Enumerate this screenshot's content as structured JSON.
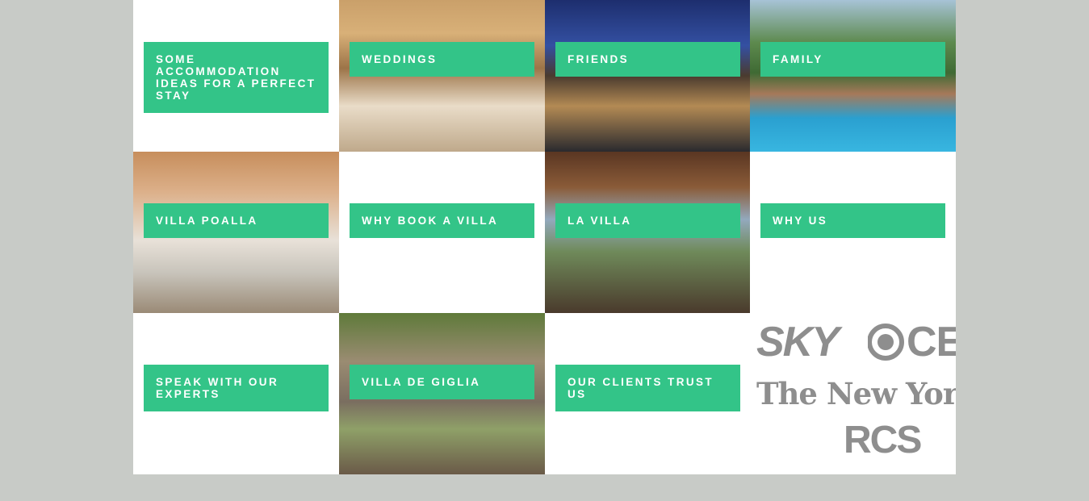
{
  "tiles": [
    {
      "label": "SOME ACCOMMODATION IDEAS FOR A PERFECT STAY"
    },
    {
      "label": "WEDDINGS"
    },
    {
      "label": "FRIENDS"
    },
    {
      "label": "FAMILY"
    },
    {
      "label": "VILLA POALLA"
    },
    {
      "label": "WHY BOOK A VILLA"
    },
    {
      "label": "LA VILLA"
    },
    {
      "label": "WHY US"
    },
    {
      "label": "SPEAK WITH OUR EXPERTS"
    },
    {
      "label": "VILLA DE GIGLIA"
    },
    {
      "label": "OUR CLIENTS TRUST US"
    }
  ],
  "press_logos": {
    "sky": "SKY",
    "cbs": "CE",
    "nyt": "The New York Ti",
    "rcs": "RCS"
  },
  "colors": {
    "accent": "#33c488",
    "page_bg": "#c8cbc7",
    "tile_bg": "#ffffff",
    "logo_gray": "#8e8e8e"
  }
}
